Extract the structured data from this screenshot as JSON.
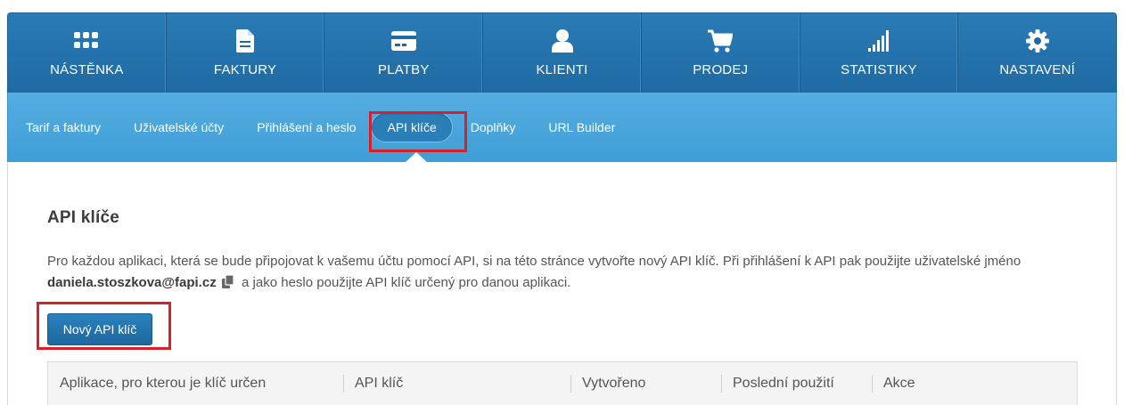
{
  "topnav": [
    {
      "label": "NÁSTĚNKA",
      "icon": "dashboard-grid-icon"
    },
    {
      "label": "FAKTURY",
      "icon": "document-icon"
    },
    {
      "label": "PLATBY",
      "icon": "credit-card-icon"
    },
    {
      "label": "KLIENTI",
      "icon": "user-icon"
    },
    {
      "label": "PRODEJ",
      "icon": "cart-icon"
    },
    {
      "label": "STATISTIKY",
      "icon": "signal-bars-icon"
    },
    {
      "label": "NASTAVENÍ",
      "icon": "gear-icon"
    }
  ],
  "subnav": [
    {
      "label": "Tarif a faktury"
    },
    {
      "label": "Uživatelské účty"
    },
    {
      "label": "Přihlášení a heslo"
    },
    {
      "label": "API klíče",
      "active": true
    },
    {
      "label": "Doplňky"
    },
    {
      "label": "URL Builder"
    }
  ],
  "page": {
    "title": "API klíče",
    "desc_before": "Pro každou aplikaci, která se bude připojovat k vašemu účtu pomocí API, si na této stránce vytvořte nový API klíč. Při přihlášení k API pak použijte uživatelské jméno ",
    "username": "daniela.stoszkova@fapi.cz",
    "desc_after": " a jako heslo použijte API klíč určený pro danou aplikaci.",
    "new_key_button": "Nový API klíč"
  },
  "table": {
    "columns": [
      "Aplikace, pro kterou je klíč určen",
      "API klíč",
      "Vytvořeno",
      "Poslední použití",
      "Akce"
    ]
  },
  "colors": {
    "nav_dark": "#2a7bb6",
    "nav_light": "#4aa6dc",
    "highlight": "#d9202a"
  }
}
